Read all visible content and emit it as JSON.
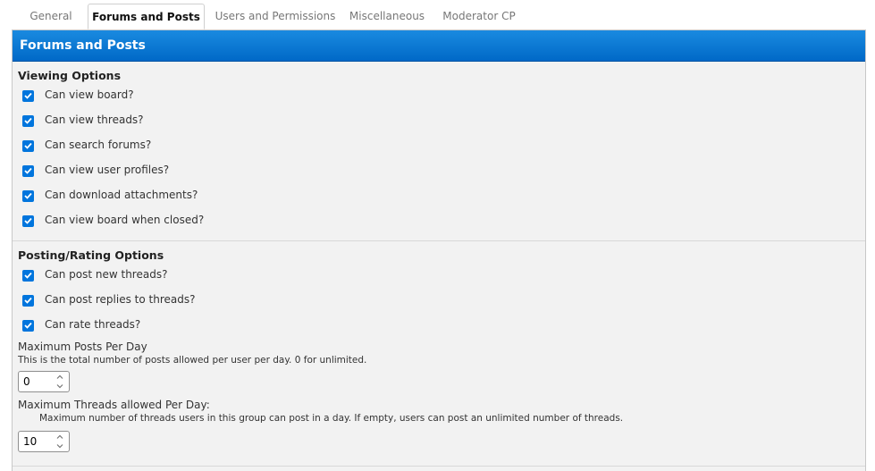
{
  "tabs": [
    {
      "label": "General"
    },
    {
      "label": "Forums and Posts"
    },
    {
      "label": "Users and Permissions"
    },
    {
      "label": "Miscellaneous"
    },
    {
      "label": "Moderator CP"
    }
  ],
  "panel": {
    "title": "Forums and Posts"
  },
  "viewing": {
    "title": "Viewing Options",
    "items": [
      {
        "label": "Can view board?",
        "checked": true
      },
      {
        "label": "Can view threads?",
        "checked": true
      },
      {
        "label": "Can search forums?",
        "checked": true
      },
      {
        "label": "Can view user profiles?",
        "checked": true
      },
      {
        "label": "Can download attachments?",
        "checked": true
      },
      {
        "label": "Can view board when closed?",
        "checked": true
      }
    ]
  },
  "posting": {
    "title": "Posting/Rating Options",
    "items": [
      {
        "label": "Can post new threads?",
        "checked": true
      },
      {
        "label": "Can post replies to threads?",
        "checked": true
      },
      {
        "label": "Can rate threads?",
        "checked": true
      }
    ],
    "max_posts": {
      "label": "Maximum Posts Per Day",
      "description": "This is the total number of posts allowed per user per day. 0 for unlimited.",
      "value": "0"
    },
    "max_threads": {
      "label": "Maximum Threads allowed Per Day:",
      "description": "Maximum number of threads users in this group can post in a day. If empty, users can post an unlimited number of threads.",
      "value": "10"
    }
  },
  "colors": {
    "header_blue": "#0a7ad6",
    "checkbox_blue": "#0075dd",
    "panel_bg": "#f2f2f2"
  }
}
